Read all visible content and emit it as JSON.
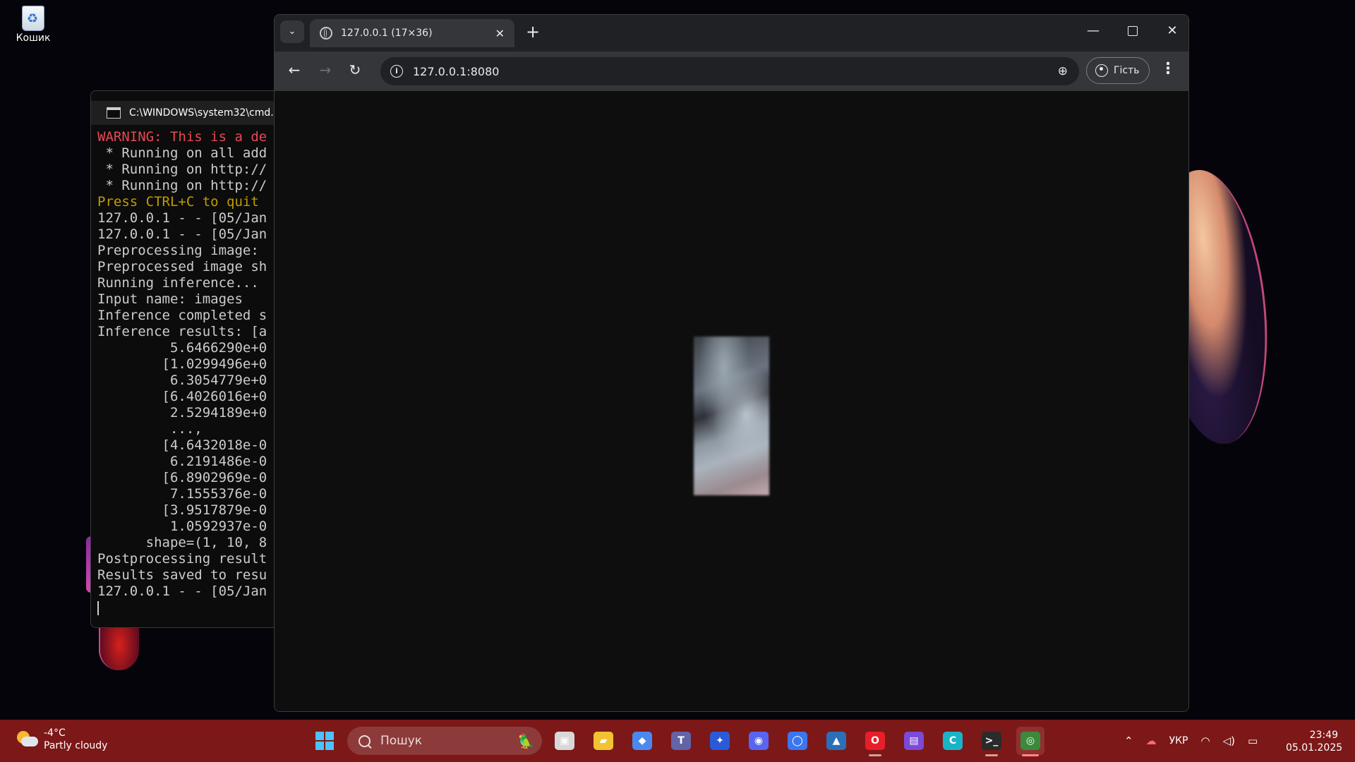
{
  "desktop": {
    "recycle_bin_label": "Кошик"
  },
  "cmd": {
    "title": "C:\\WINDOWS\\system32\\cmd.e",
    "lines": [
      {
        "text": "WARNING: This is a de",
        "style": "warn"
      },
      {
        "text": " * Running on all add",
        "style": ""
      },
      {
        "text": " * Running on http://",
        "style": ""
      },
      {
        "text": " * Running on http://",
        "style": ""
      },
      {
        "text": "Press CTRL+C to quit",
        "style": "quit"
      },
      {
        "text": "127.0.0.1 - - [05/Jan",
        "style": ""
      },
      {
        "text": "127.0.0.1 - - [05/Jan",
        "style": ""
      },
      {
        "text": "Preprocessing image: ",
        "style": ""
      },
      {
        "text": "Preprocessed image sh",
        "style": ""
      },
      {
        "text": "Running inference... ",
        "style": ""
      },
      {
        "text": "Input name: images",
        "style": ""
      },
      {
        "text": "Inference completed s",
        "style": ""
      },
      {
        "text": "Inference results: [a",
        "style": ""
      },
      {
        "text": "         5.6466290e+0",
        "style": ""
      },
      {
        "text": "        [1.0299496e+0",
        "style": ""
      },
      {
        "text": "         6.3054779e+0",
        "style": ""
      },
      {
        "text": "        [6.4026016e+0",
        "style": ""
      },
      {
        "text": "         2.5294189e+0",
        "style": ""
      },
      {
        "text": "         ...,",
        "style": ""
      },
      {
        "text": "        [4.6432018e-0",
        "style": ""
      },
      {
        "text": "         6.2191486e-0",
        "style": ""
      },
      {
        "text": "        [6.8902969e-0",
        "style": ""
      },
      {
        "text": "         7.1555376e-0",
        "style": ""
      },
      {
        "text": "        [3.9517879e-0",
        "style": ""
      },
      {
        "text": "         1.0592937e-0",
        "style": ""
      },
      {
        "text": "      shape=(1, 10, 8",
        "style": ""
      },
      {
        "text": "Postprocessing result",
        "style": ""
      },
      {
        "text": "Results saved to resu",
        "style": ""
      },
      {
        "text": "127.0.0.1 - - [05/Jan",
        "style": ""
      }
    ]
  },
  "browser": {
    "tab_title": "127.0.0.1 (17×36)",
    "url": "127.0.0.1:8080",
    "profile_label": "Гість",
    "new_tab_glyph": "+",
    "menu_glyph": "⋮"
  },
  "taskbar": {
    "weather_temp": "-4°C",
    "weather_condition": "Partly cloudy",
    "search_placeholder": "Пошук",
    "language": "УКР",
    "time": "23:49",
    "date": "05.01.2025",
    "apps": [
      {
        "name": "task-view",
        "color": "#d8d8d8"
      },
      {
        "name": "file-explorer",
        "color": "#f2c230"
      },
      {
        "name": "copilot",
        "color": "#4a8af0"
      },
      {
        "name": "teams",
        "color": "#6264a7"
      },
      {
        "name": "visual-studio",
        "color": "#2a5ad8"
      },
      {
        "name": "discord",
        "color": "#5865f2"
      },
      {
        "name": "signal",
        "color": "#3a76f0"
      },
      {
        "name": "photos",
        "color": "#2a6fb8"
      },
      {
        "name": "opera",
        "color": "#e81e2a"
      },
      {
        "name": "clipchamp",
        "color": "#7a4ad8"
      },
      {
        "name": "canva",
        "color": "#19b4c8"
      },
      {
        "name": "terminal",
        "color": "#2a2a2a"
      },
      {
        "name": "chrome",
        "color": "#3a8a3a"
      }
    ]
  }
}
